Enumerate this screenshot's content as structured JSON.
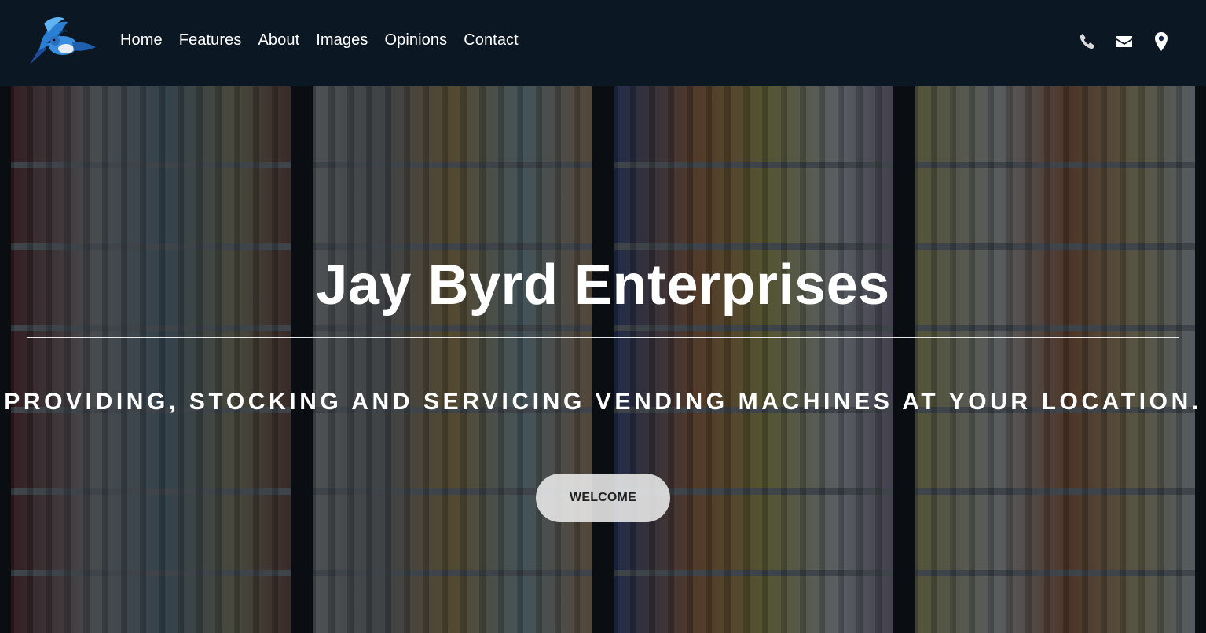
{
  "nav": {
    "items": [
      {
        "label": "Home"
      },
      {
        "label": "Features"
      },
      {
        "label": "About"
      },
      {
        "label": "Images"
      },
      {
        "label": "Opinions"
      },
      {
        "label": "Contact"
      }
    ]
  },
  "header": {
    "logo_icon": "blue-jay-bird-icon",
    "contact_icons": [
      "phone-icon",
      "envelope-icon",
      "map-marker-icon"
    ]
  },
  "hero": {
    "title": "Jay Byrd Enterprises",
    "subtitle": "PROVIDING, STOCKING AND SERVICING VENDING MACHINES AT YOUR LOCATION.",
    "button_label": "WELCOME"
  },
  "colors": {
    "header_bg": "#0f2744",
    "text": "#ffffff",
    "button_bg": "#ebebeb",
    "icon": "#e6e6e6"
  }
}
